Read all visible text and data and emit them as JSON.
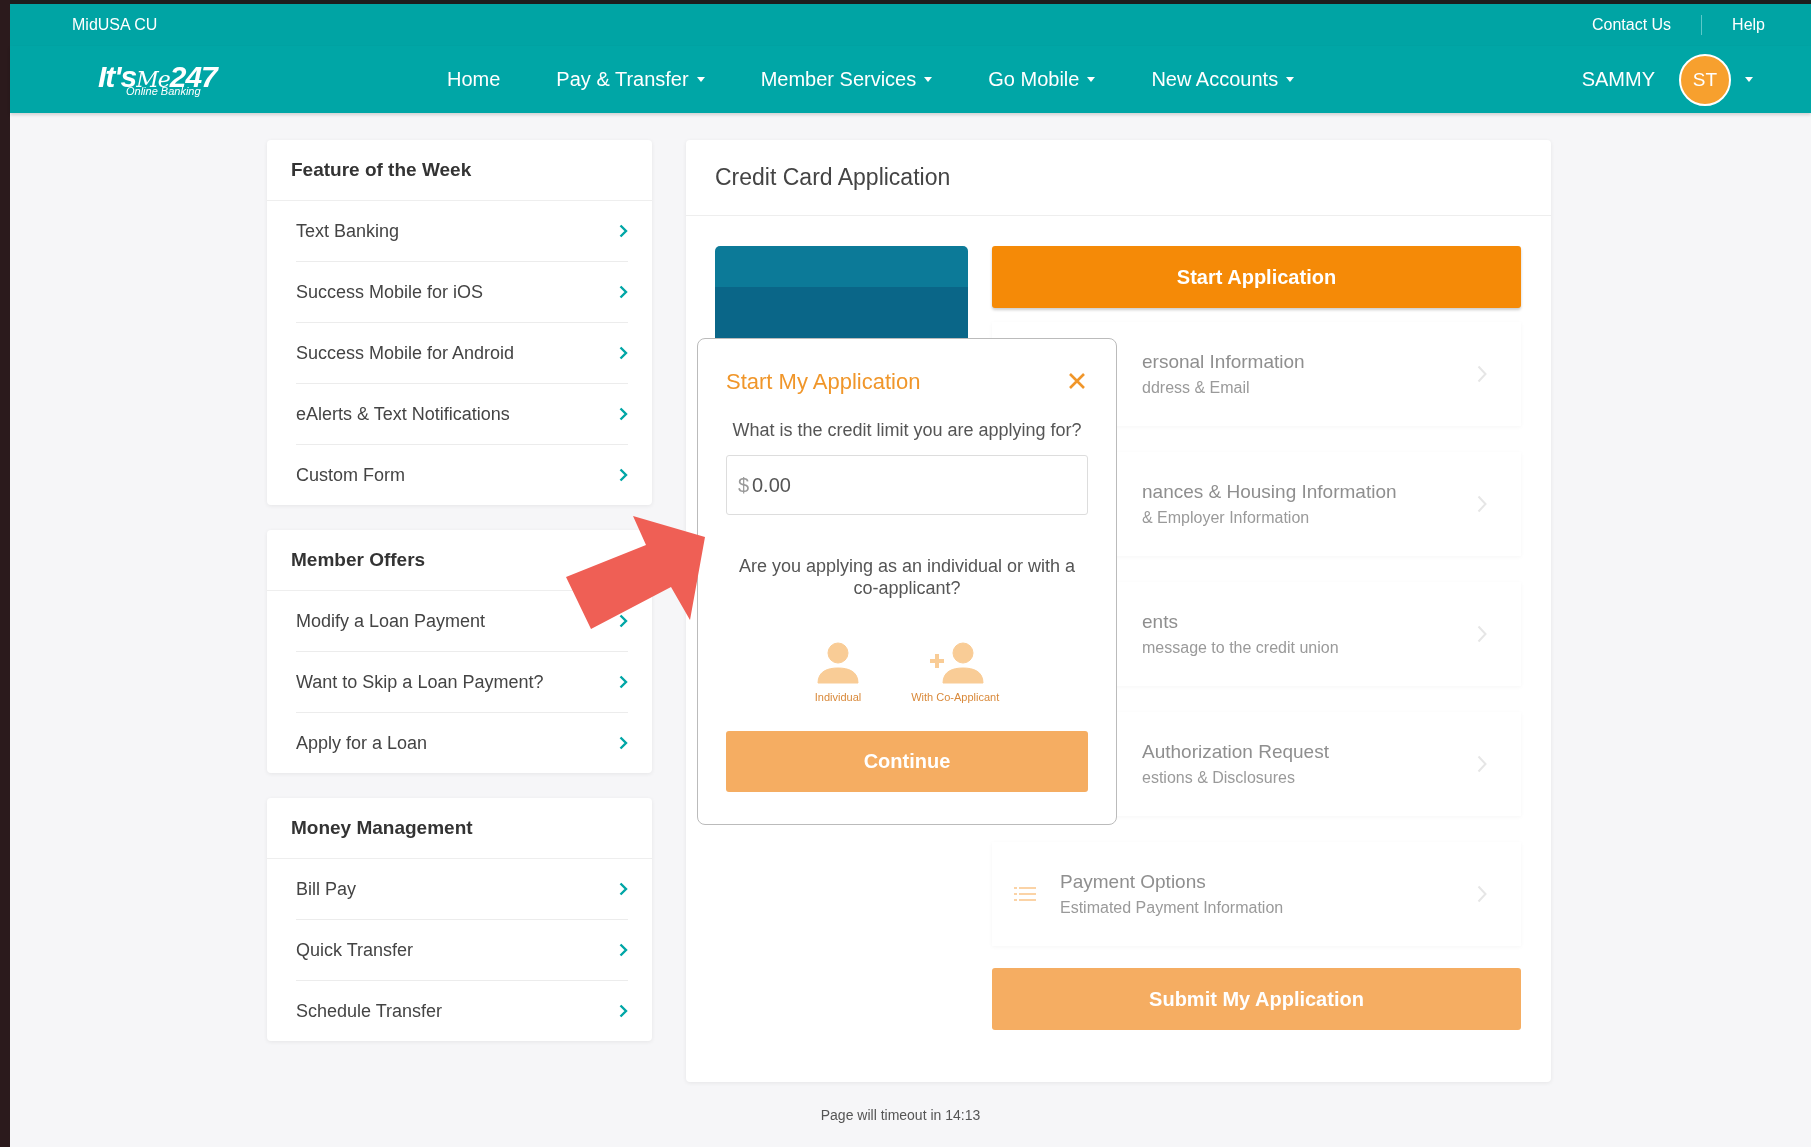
{
  "top_bar": {
    "brand": "MidUSA CU",
    "links": [
      "Contact Us",
      "Help"
    ]
  },
  "logo": {
    "main": "It's",
    "script": "Me",
    "number": "247",
    "tagline": "Online Banking"
  },
  "nav": [
    {
      "label": "Home",
      "has_menu": false
    },
    {
      "label": "Pay & Transfer",
      "has_menu": true
    },
    {
      "label": "Member Services",
      "has_menu": true
    },
    {
      "label": "Go Mobile",
      "has_menu": true
    },
    {
      "label": "New Accounts",
      "has_menu": true
    }
  ],
  "user": {
    "name": "SAMMY",
    "initials": "ST"
  },
  "sidebar": [
    {
      "title": "Feature of the Week",
      "items": [
        "Text Banking",
        "Success Mobile for iOS",
        "Success Mobile for Android",
        "eAlerts & Text Notifications",
        "Custom Form"
      ]
    },
    {
      "title": "Member Offers",
      "items": [
        "Modify a Loan Payment",
        "Want to Skip a Loan Payment?",
        "Apply for a Loan"
      ]
    },
    {
      "title": "Money Management",
      "items": [
        "Bill Pay",
        "Quick Transfer",
        "Schedule Transfer"
      ]
    }
  ],
  "card": {
    "title": "Credit Card Application",
    "start_button": "Start Application",
    "submit_button": "Submit My Application",
    "steps": [
      {
        "kind": "covered",
        "title": "ersonal Information",
        "subtitle": "ddress & Email"
      },
      {
        "kind": "covered",
        "title": "nances & Housing Information",
        "subtitle": "& Employer Information"
      },
      {
        "kind": "covered",
        "title": "ents",
        "subtitle": "message to the credit union"
      },
      {
        "kind": "covered",
        "title": "Authorization Request",
        "subtitle": "estions & Disclosures"
      },
      {
        "kind": "list",
        "title": "Payment Options",
        "subtitle": "Estimated Payment Information"
      }
    ]
  },
  "modal": {
    "title": "Start My Application",
    "question": "What is the credit limit you are applying for?",
    "prefix": "$",
    "value": "0.00",
    "question_2": "Are you applying as an individual or with a co-applicant?",
    "options": [
      {
        "kind": "individual",
        "label": "Individual",
        "selected": false
      },
      {
        "kind": "co-applicant",
        "label": "With Co-Applicant",
        "selected": false
      }
    ],
    "continue_button": {
      "label": "Continue",
      "disabled": true
    }
  },
  "footer": {
    "timeout": "Page will timeout in 14:13"
  }
}
